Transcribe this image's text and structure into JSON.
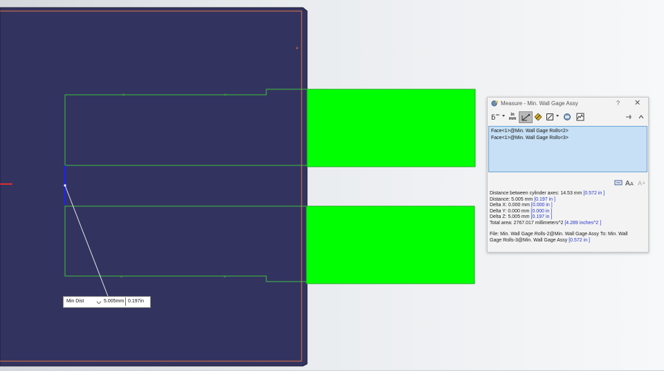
{
  "colors": {
    "part_face": "#333360",
    "part_edge": "#e2793f",
    "roll_green": "#00ff00",
    "sketch_line": "#3cc23c",
    "selected_edge": "#1a22ff",
    "link_blue": "#2333c8"
  },
  "measure_dialog": {
    "title": "Measure - Min. Wall Gage Assy",
    "help_label": "?",
    "close_label": "✕",
    "toolbar_icons": [
      "arc-circle-measure-icon",
      "units-precision-icon",
      "show-xyz-measurements-icon",
      "point-to-point-icon",
      "projection-icon",
      "measurement-history-icon",
      "create-sensor-icon",
      "pin-icon",
      "collapse-icon"
    ],
    "units_label_top": "in",
    "units_label_bottom": "mm",
    "selections": [
      "Face<1>@Min. Wall Gage Rolls<2>",
      "Face<1>@Min. Wall Gage Rolls<3>"
    ],
    "results": {
      "cylinder_axes_label": "Distance between cylinder axes:  14.53 mm",
      "cylinder_axes_in": "[0.572 in ]",
      "distance_label": "Distance: 5.005 mm",
      "distance_in": "[0.197 in ]",
      "delta_x_label": "Delta X: 0.000 mm",
      "delta_x_in": "[0.000 in ]",
      "delta_y_label": "Delta Y: 0.000 mm",
      "delta_y_in": "[0.000 in ]",
      "delta_z_label": "Delta Z: 5.005 mm",
      "delta_z_in": "[0.197 in ]",
      "total_area_label": "Total area: 2767.017 millimeters^2",
      "total_area_in": "[4.289 inches^2 ]",
      "file_line1": "File: Min. Wall Gage Rolls-2@Min. Wall Gage Assy To: Min. Wall",
      "file_line2": "Gage Rolls-3@Min. Wall Gage Assy",
      "file_in": "[0.572 in ]"
    }
  },
  "callout": {
    "mode_label": "Min Dist",
    "value_mm": "5.005mm",
    "value_in": "0.197in"
  }
}
